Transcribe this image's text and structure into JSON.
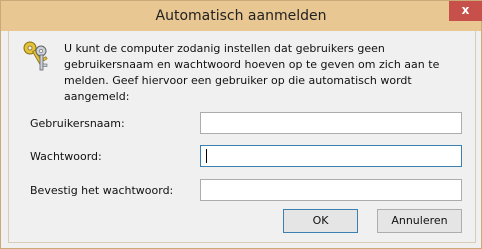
{
  "window": {
    "title": "Automatisch aanmelden",
    "close_glyph": "x",
    "icon": "keys-icon"
  },
  "description": "U kunt de computer zodanig instellen dat gebruikers geen gebruikersnaam en wachtwoord hoeven op te geven om zich aan te melden. Geef hiervoor een gebruiker op die automatisch wordt aangemeld:",
  "form": {
    "username_label": "Gebruikersnaam:",
    "username_value": "",
    "password_label": "Wachtwoord:",
    "password_value": "",
    "confirm_label": "Bevestig het wachtwoord:",
    "confirm_value": ""
  },
  "buttons": {
    "ok_label": "OK",
    "cancel_label": "Annuleren"
  },
  "colors": {
    "title_bar": "#e8c792",
    "close_button": "#c7504b",
    "focus_border": "#3c7fb1"
  }
}
